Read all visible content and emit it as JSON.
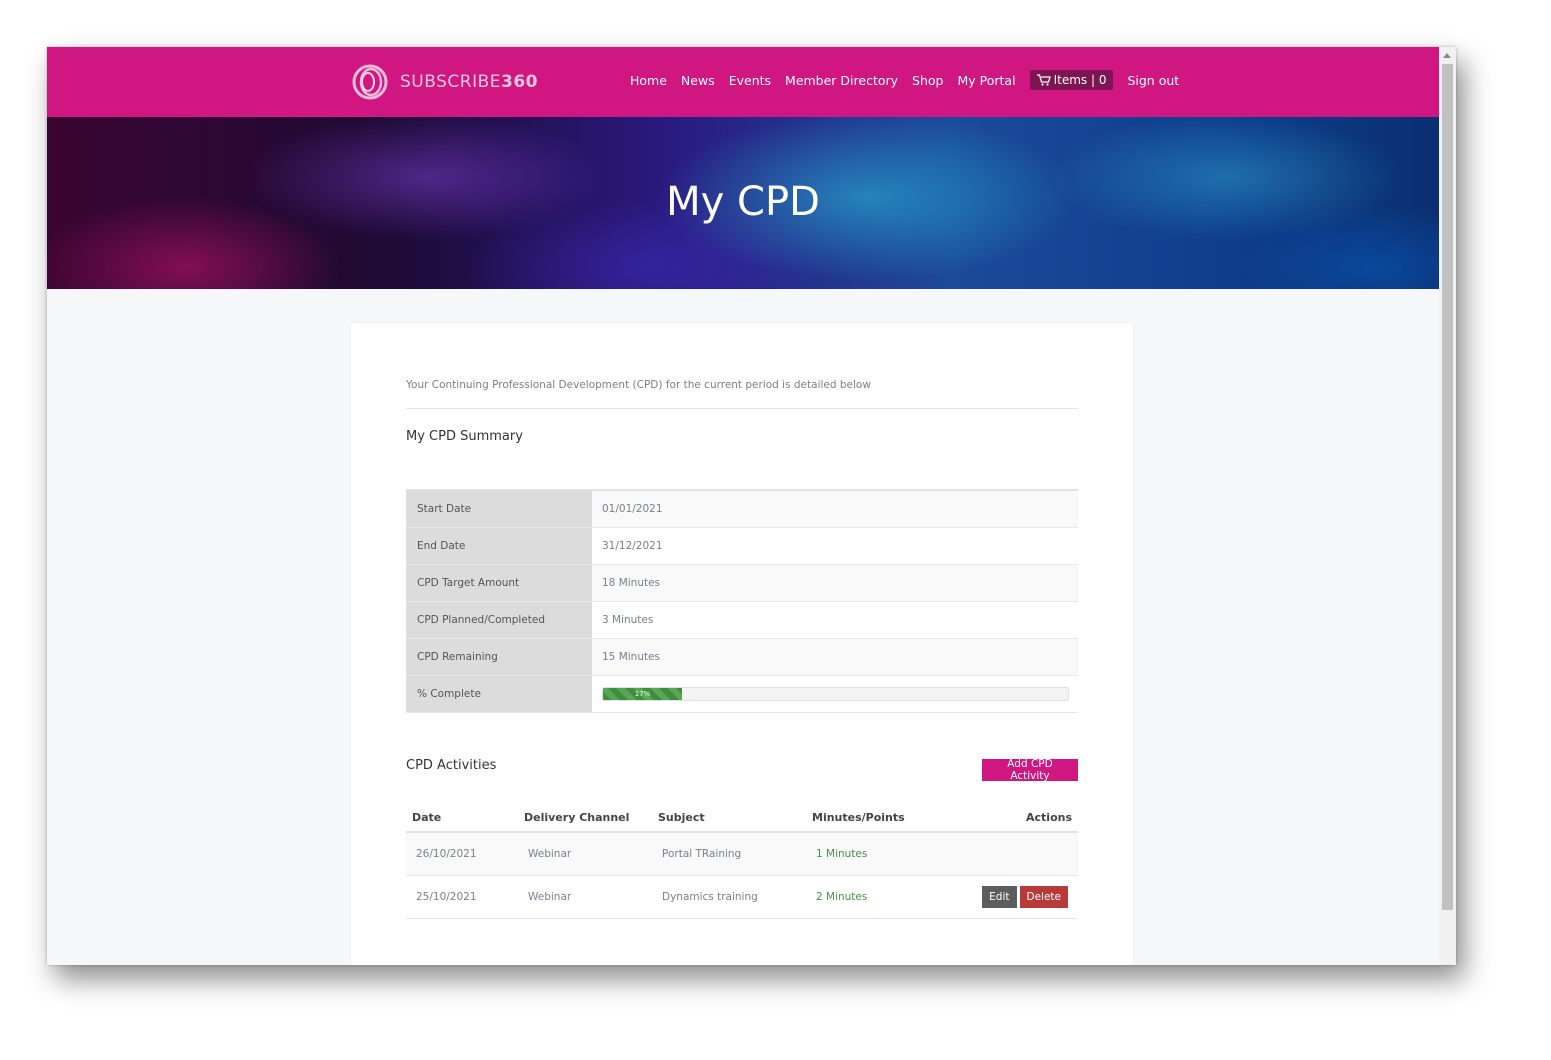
{
  "brand": {
    "name_light": "SUBSCRIBE",
    "name_bold": "360",
    "accent_color": "#d01680"
  },
  "nav": {
    "items": [
      "Home",
      "News",
      "Events",
      "Member Directory",
      "Shop",
      "My Portal"
    ],
    "cart_label": "Items | 0",
    "cart_icon": "cart-icon",
    "signout": "Sign out"
  },
  "hero": {
    "title": "My CPD"
  },
  "intro": "Your Continuing Professional Development (CPD) for the current period is detailed below",
  "summary": {
    "title": "My CPD Summary",
    "rows": [
      {
        "label": "Start Date",
        "value": "01/01/2021"
      },
      {
        "label": "End Date",
        "value": "31/12/2021"
      },
      {
        "label": "CPD Target Amount",
        "value": "18 Minutes"
      },
      {
        "label": "CPD Planned/Completed",
        "value": "3 Minutes"
      },
      {
        "label": "CPD Remaining",
        "value": "15 Minutes"
      }
    ],
    "progress_label": "% Complete",
    "progress_text": "17%",
    "progress_percent": 17
  },
  "activities": {
    "title": "CPD Activities",
    "add_button": "Add CPD Activity",
    "columns": [
      "Date",
      "Delivery Channel",
      "Subject",
      "Minutes/Points",
      "Actions"
    ],
    "rows": [
      {
        "date": "26/10/2021",
        "channel": "Webinar",
        "subject": "Portal TRaining",
        "minutes": "1 Minutes",
        "editable": false
      },
      {
        "date": "25/10/2021",
        "channel": "Webinar",
        "subject": "Dynamics training",
        "minutes": "2 Minutes",
        "editable": true
      }
    ],
    "edit_label": "Edit",
    "delete_label": "Delete"
  }
}
